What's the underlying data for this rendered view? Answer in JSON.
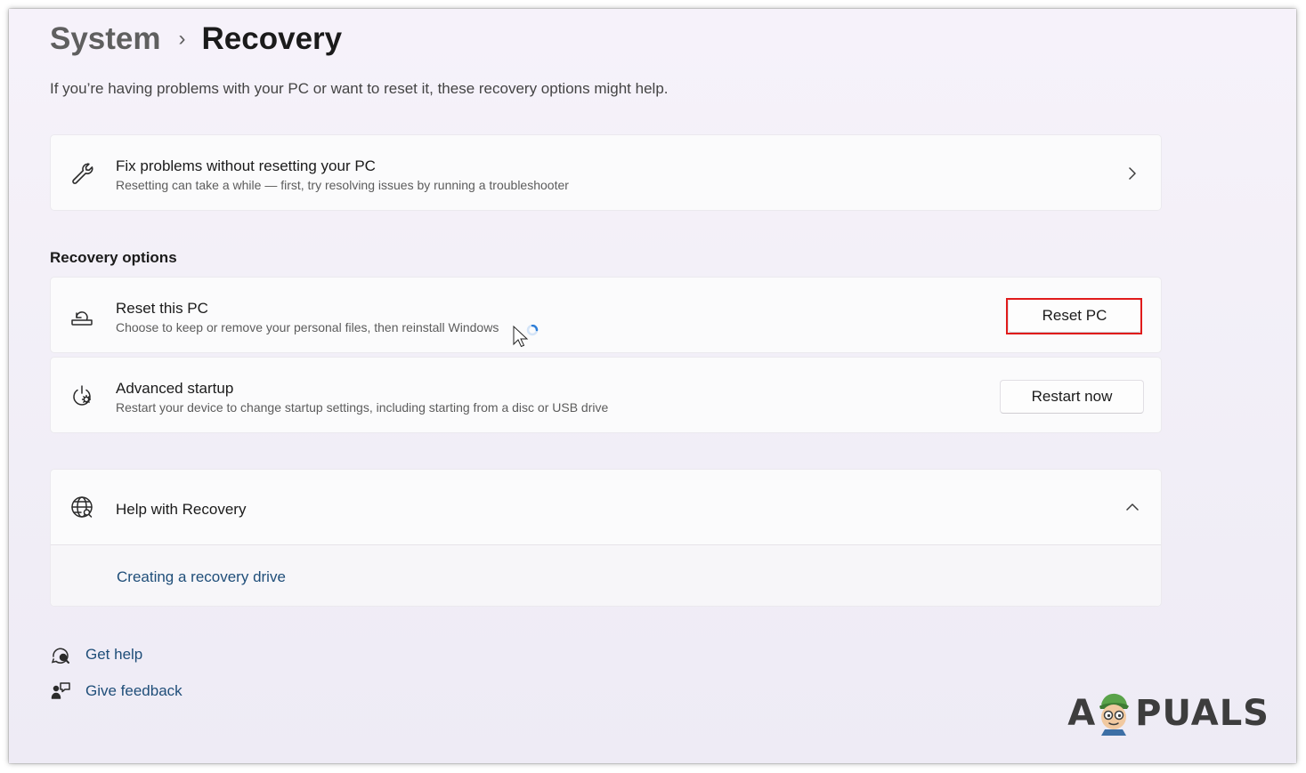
{
  "header": {
    "breadcrumb_parent": "System",
    "breadcrumb_separator": "›",
    "page_title": "Recovery"
  },
  "description": "If you’re having problems with your PC or want to reset it, these recovery options might help.",
  "fix_card": {
    "title": "Fix problems without resetting your PC",
    "subtitle": "Resetting can take a while — first, try resolving issues by running a troubleshooter",
    "icon": "wrench-icon"
  },
  "recovery_options": {
    "heading": "Recovery options",
    "items": [
      {
        "title": "Reset this PC",
        "subtitle": "Choose to keep or remove your personal files, then reinstall Windows",
        "button_label": "Reset PC",
        "icon": "reset-pc-icon",
        "highlighted": true
      },
      {
        "title": "Advanced startup",
        "subtitle": "Restart your device to change startup settings, including starting from a disc or USB drive",
        "button_label": "Restart now",
        "icon": "advanced-startup-icon",
        "highlighted": false
      }
    ]
  },
  "help": {
    "title": "Help with Recovery",
    "expanded": true,
    "links": [
      "Creating a recovery drive"
    ],
    "icon": "globe-help-icon"
  },
  "footer": {
    "get_help": "Get help",
    "give_feedback": "Give feedback"
  },
  "watermark": {
    "text_left": "A",
    "text_right": "PUALS"
  },
  "colors": {
    "accent_link": "#1f4e79",
    "highlight": "#e01b1b",
    "background": "#f3f0f8",
    "card": "#fbfbfc"
  }
}
